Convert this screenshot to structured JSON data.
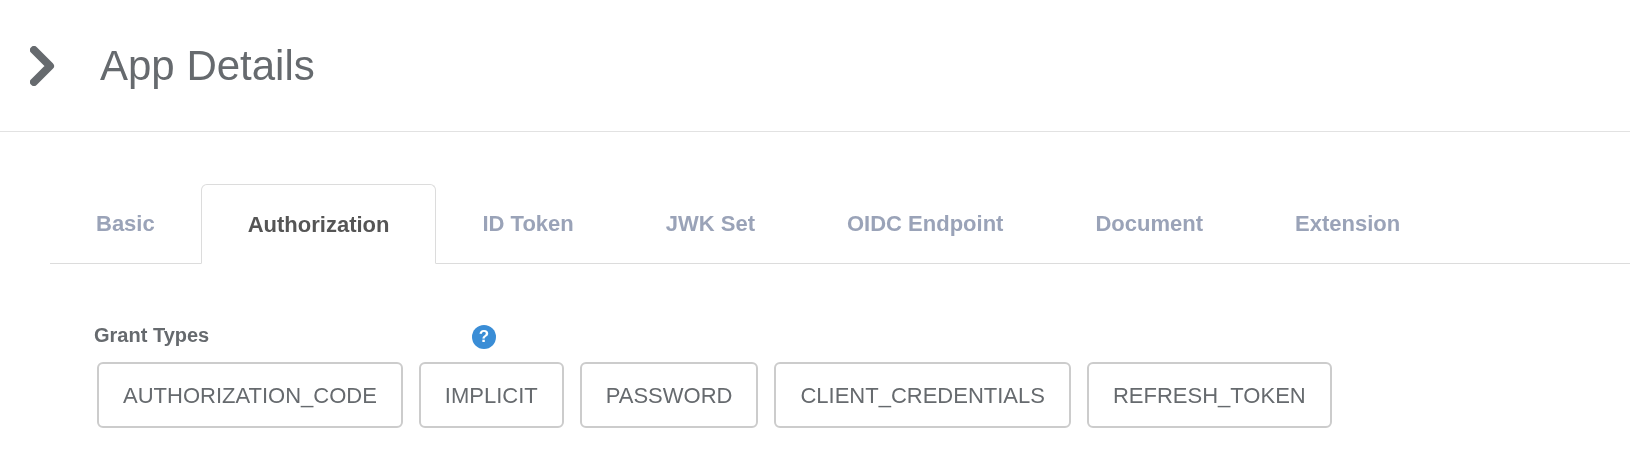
{
  "header": {
    "title": "App Details"
  },
  "tabs": [
    {
      "label": "Basic",
      "selected": false
    },
    {
      "label": "Authorization",
      "selected": true
    },
    {
      "label": "ID Token",
      "selected": false
    },
    {
      "label": "JWK Set",
      "selected": false
    },
    {
      "label": "OIDC Endpoint",
      "selected": false
    },
    {
      "label": "Document",
      "selected": false
    },
    {
      "label": "Extension",
      "selected": false
    }
  ],
  "grant_types": {
    "label": "Grant Types",
    "help_icon": "?",
    "options": [
      "AUTHORIZATION_CODE",
      "IMPLICIT",
      "PASSWORD",
      "CLIENT_CREDENTIALS",
      "REFRESH_TOKEN"
    ]
  }
}
